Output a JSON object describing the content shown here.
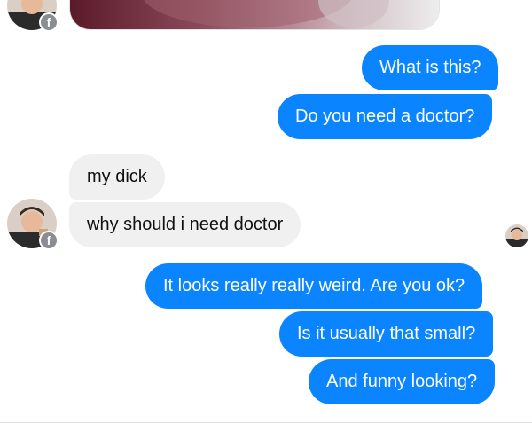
{
  "messages": [
    {
      "direction": "outgoing",
      "text": "What is this?"
    },
    {
      "direction": "outgoing",
      "text": "Do you need a doctor?"
    },
    {
      "direction": "incoming",
      "text": "my  dick"
    },
    {
      "direction": "incoming",
      "text": "why should i need doctor"
    },
    {
      "direction": "outgoing",
      "text": "It looks really really weird.  Are you ok?"
    },
    {
      "direction": "outgoing",
      "text": "Is it usually that small?"
    },
    {
      "direction": "outgoing",
      "text": "And funny looking?"
    }
  ],
  "badge_icon": "facebook-icon",
  "colors": {
    "outgoing_bubble": "#0a84ff",
    "incoming_bubble": "#f1f0f0",
    "badge": "#8a8d91"
  }
}
